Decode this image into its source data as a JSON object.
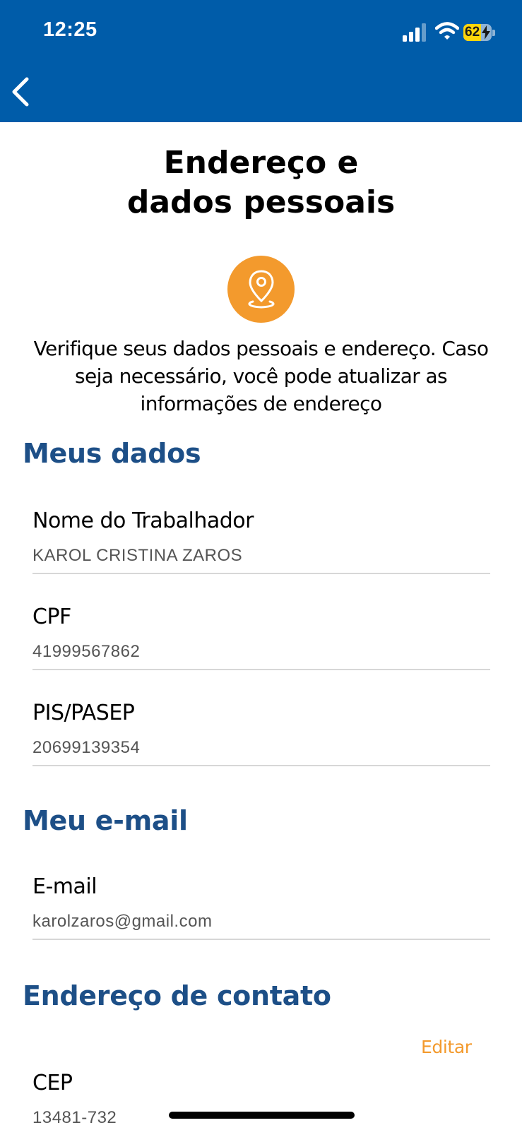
{
  "status_bar": {
    "time": "12:25",
    "battery_level": "62",
    "battery_fraction": 0.62,
    "signal_bars_active": 3,
    "signal_bars_total": 4
  },
  "colors": {
    "header_bg": "#005ca9",
    "accent": "#f39a2d",
    "section_title": "#1d4f87"
  },
  "navigation": {
    "back_icon": "chevron-left-icon"
  },
  "page": {
    "title_line1": "Endereço e",
    "title_line2": "dados pessoais",
    "badge_icon": "location-pin-icon",
    "intro": "Verifique seus dados pessoais e endereço. Caso seja necessário, você pode atualizar as informações de endereço"
  },
  "sections": {
    "meus_dados": {
      "title": "Meus dados",
      "fields": [
        {
          "label": "Nome do Trabalhador",
          "value": "KAROL CRISTINA ZAROS"
        },
        {
          "label": "CPF",
          "value": "41999567862"
        },
        {
          "label": "PIS/PASEP",
          "value": "20699139354"
        }
      ]
    },
    "meu_email": {
      "title": "Meu e-mail",
      "fields": [
        {
          "label": "E-mail",
          "value": "karolzaros@gmail.com"
        }
      ]
    },
    "endereco": {
      "title": "Endereço de contato",
      "edit_label": "Editar",
      "fields": [
        {
          "label": "CEP",
          "value": "13481-732"
        }
      ]
    }
  }
}
